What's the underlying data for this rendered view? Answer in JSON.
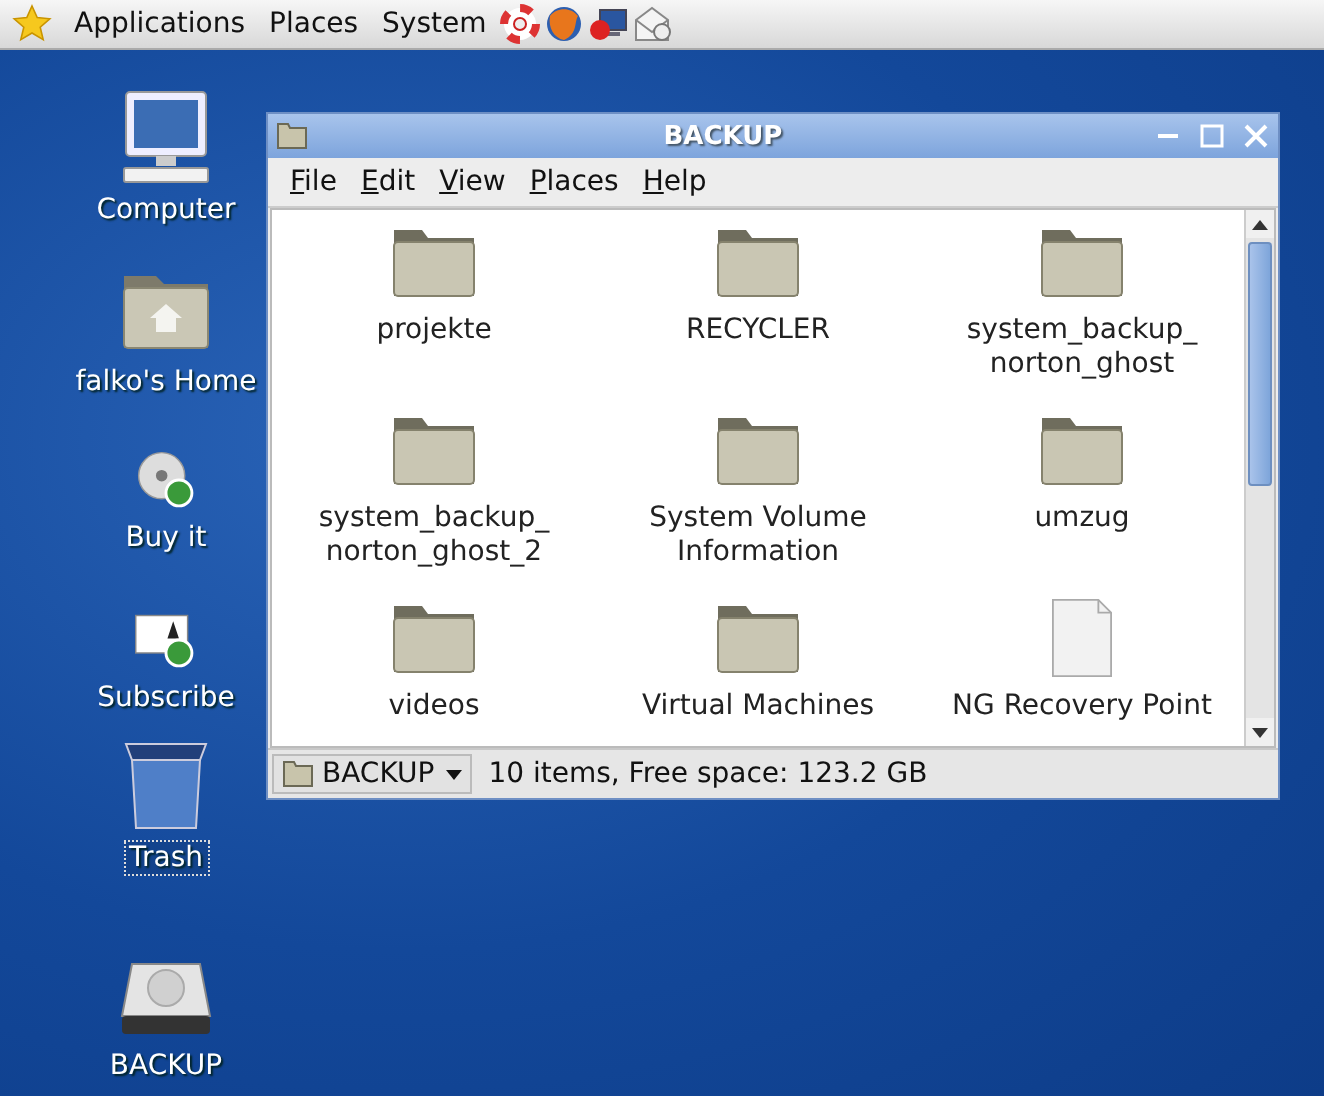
{
  "top_panel": {
    "menus": [
      {
        "label": "Applications"
      },
      {
        "label": "Places"
      },
      {
        "label": "System"
      }
    ]
  },
  "desktop_icons": [
    {
      "label": "Computer",
      "kind": "computer",
      "selected": false
    },
    {
      "label": "falko's Home",
      "kind": "home",
      "selected": false
    },
    {
      "label": "Buy it",
      "kind": "disc",
      "selected": false
    },
    {
      "label": "Subscribe",
      "kind": "subscribe",
      "selected": false
    },
    {
      "label": "Trash",
      "kind": "trash",
      "selected": true
    },
    {
      "label": "BACKUP",
      "kind": "drive",
      "selected": false
    }
  ],
  "window": {
    "title": "BACKUP",
    "menus": [
      {
        "label": "File"
      },
      {
        "label": "Edit"
      },
      {
        "label": "View"
      },
      {
        "label": "Places"
      },
      {
        "label": "Help"
      }
    ],
    "files": [
      {
        "name": "projekte",
        "kind": "folder"
      },
      {
        "name": "RECYCLER",
        "kind": "folder"
      },
      {
        "name": "system_backup_ norton_ghost",
        "kind": "folder"
      },
      {
        "name": "system_backup_ norton_ghost_2",
        "kind": "folder"
      },
      {
        "name": "System Volume Information",
        "kind": "folder"
      },
      {
        "name": "umzug",
        "kind": "folder"
      },
      {
        "name": "videos",
        "kind": "folder"
      },
      {
        "name": "Virtual Machines",
        "kind": "folder"
      },
      {
        "name": "NG Recovery Point",
        "kind": "file"
      }
    ],
    "status_bar": {
      "location": "BACKUP",
      "info": "10 items, Free space: 123.2 GB"
    }
  }
}
